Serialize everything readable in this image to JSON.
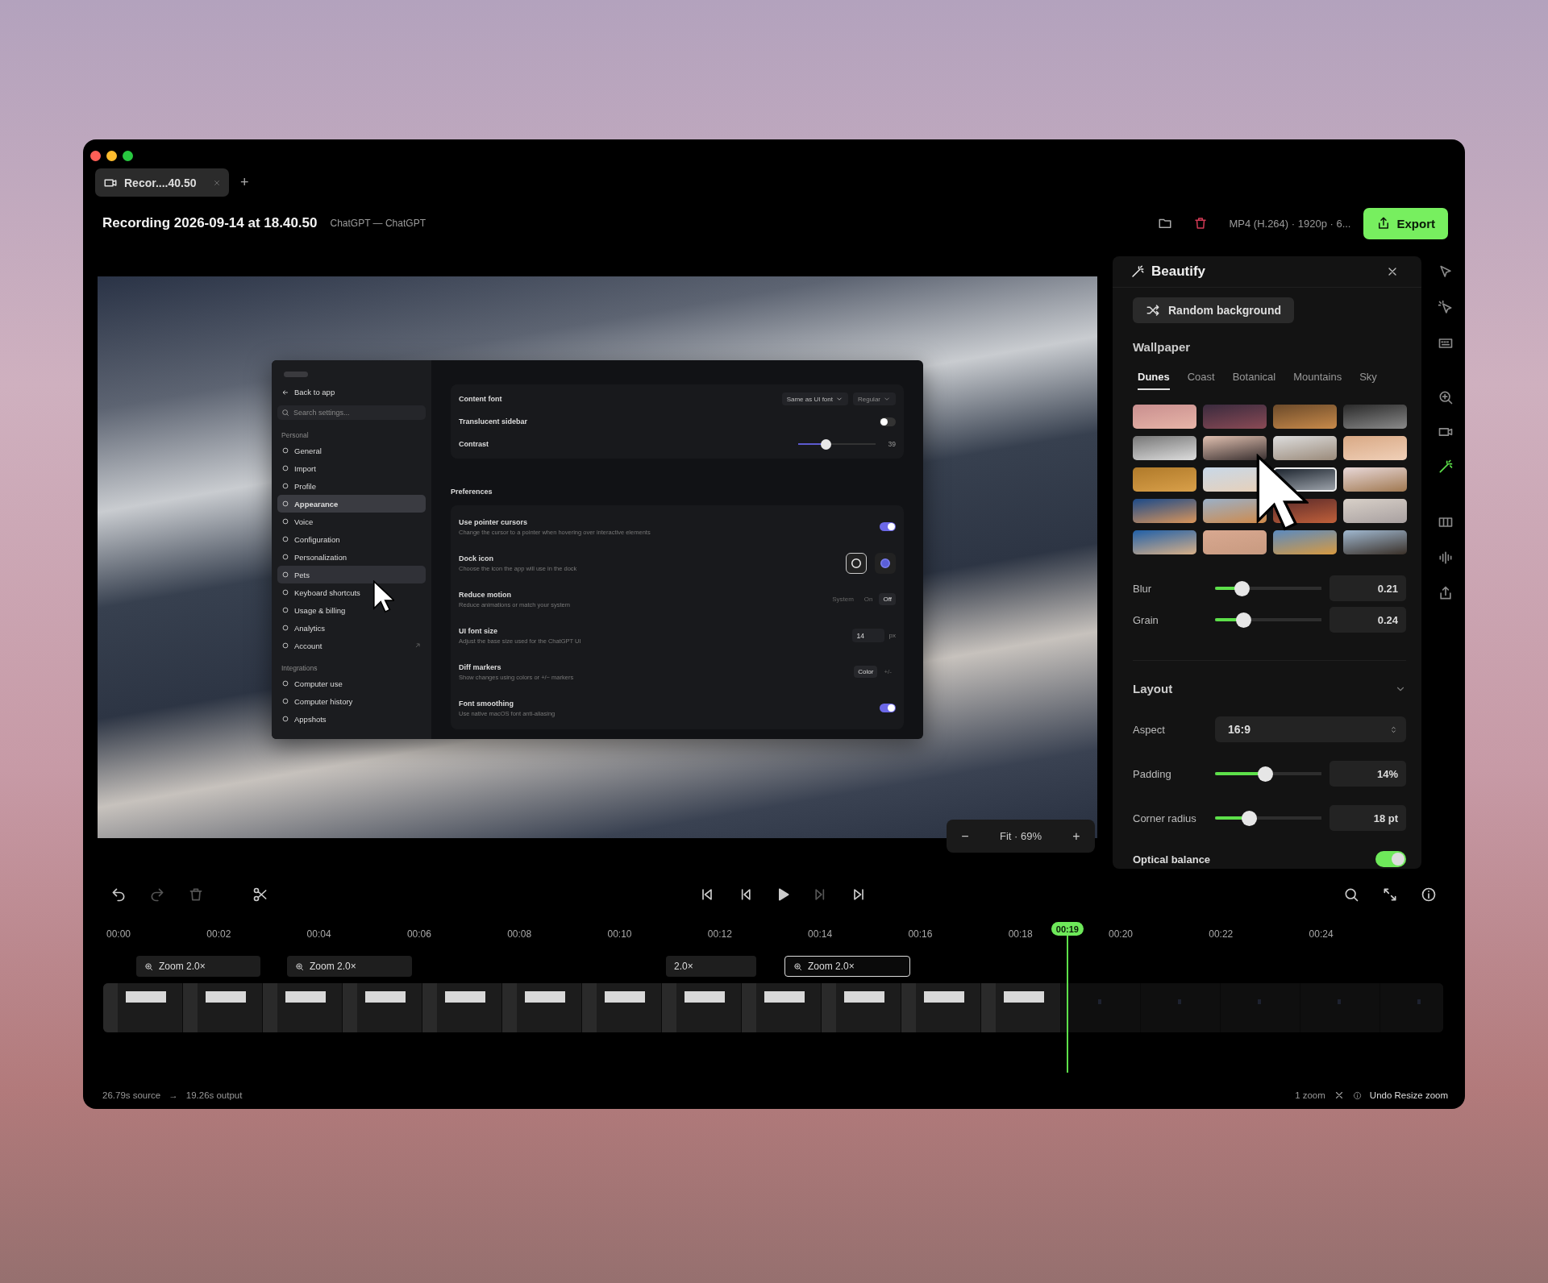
{
  "window": {
    "title": "Recording 2026-09-14 at 18.40.50",
    "subtitle": "ChatGPT — ChatGPT"
  },
  "tabs": [
    {
      "label": "Recor....40.50",
      "selected": true
    }
  ],
  "new_tab": "+",
  "toolbar": {
    "format": "MP4 (H.264) · 1920p · 6...",
    "export": "Export"
  },
  "preview": {
    "app": {
      "back": "Back to app",
      "search_placeholder": "Search settings...",
      "sections": [
        {
          "heading": "Personal",
          "items": [
            {
              "label": "General",
              "kind": "page",
              "selected": false,
              "hovered": false
            },
            {
              "label": "Import",
              "kind": "page",
              "selected": false,
              "hovered": false
            },
            {
              "label": "Profile",
              "kind": "page",
              "selected": false,
              "hovered": false
            },
            {
              "label": "Appearance",
              "kind": "page",
              "selected": true,
              "hovered": false
            },
            {
              "label": "Voice",
              "kind": "page",
              "selected": false,
              "hovered": false
            },
            {
              "label": "Configuration",
              "kind": "page",
              "selected": false,
              "hovered": false
            },
            {
              "label": "Personalization",
              "kind": "page",
              "selected": false,
              "hovered": false
            },
            {
              "label": "Pets",
              "kind": "page",
              "selected": false,
              "hovered": true
            },
            {
              "label": "Keyboard shortcuts",
              "kind": "page",
              "selected": false,
              "hovered": false
            },
            {
              "label": "Usage & billing",
              "kind": "page",
              "selected": false,
              "hovered": false
            },
            {
              "label": "Analytics",
              "kind": "page",
              "selected": false,
              "hovered": false
            },
            {
              "label": "Account",
              "kind": "external",
              "selected": false,
              "hovered": false
            }
          ]
        },
        {
          "heading": "Integrations",
          "items": [
            {
              "label": "Computer use",
              "kind": "page",
              "selected": false,
              "hovered": false
            },
            {
              "label": "Computer history",
              "kind": "page",
              "selected": false,
              "hovered": false
            },
            {
              "label": "Appshots",
              "kind": "page",
              "selected": false,
              "hovered": false
            }
          ]
        }
      ],
      "top_rows": [
        {
          "kind": "select",
          "label": "Content font",
          "options": [
            "Same as UI font",
            "Regular"
          ]
        },
        {
          "kind": "toggle",
          "label": "Translucent sidebar",
          "on": false
        },
        {
          "kind": "slider",
          "label": "Contrast",
          "level": 0.36,
          "value": "39"
        }
      ],
      "section": "Preferences",
      "rows": [
        {
          "kind": "toggle",
          "label": "Use pointer cursors",
          "description": "Change the cursor to a pointer when hovering over interactive elements",
          "on": true
        },
        {
          "kind": "icons",
          "label": "Dock icon",
          "description": "Choose the icon the app will use in the dock",
          "options": [
            {
              "selected": true
            },
            {
              "selected": false
            }
          ]
        },
        {
          "kind": "segmented",
          "label": "Reduce motion",
          "description": "Reduce animations or match your system",
          "options": [
            {
              "label": "System",
              "selected": false
            },
            {
              "label": "On",
              "selected": false
            },
            {
              "label": "Off",
              "selected": true
            }
          ]
        },
        {
          "kind": "number",
          "label": "UI font size",
          "description": "Adjust the base size used for the ChatGPT UI",
          "value": "14",
          "unit": "px"
        },
        {
          "kind": "segmented",
          "label": "Diff markers",
          "description": "Show changes using colors or +/− markers",
          "options": [
            {
              "label": "Color",
              "selected": true
            },
            {
              "label": "+/-",
              "selected": false
            }
          ]
        },
        {
          "kind": "toggle",
          "label": "Font smoothing",
          "description": "Use native macOS font anti-aliasing",
          "on": true
        }
      ]
    },
    "zoom": {
      "minus": "−",
      "label": "Fit · 69%",
      "plus": "+"
    }
  },
  "panel": {
    "title": "Beautify",
    "random_button": "Random background",
    "wallpaper": {
      "heading": "Wallpaper",
      "tabs": [
        {
          "label": "Dunes",
          "selected": true
        },
        {
          "label": "Coast",
          "selected": false
        },
        {
          "label": "Botanical",
          "selected": false
        },
        {
          "label": "Mountains",
          "selected": false
        },
        {
          "label": "Sky",
          "selected": false
        }
      ],
      "thumbnails": [
        {
          "selected": false
        },
        {
          "selected": false
        },
        {
          "selected": false
        },
        {
          "selected": false
        },
        {
          "selected": false
        },
        {
          "selected": false
        },
        {
          "selected": false
        },
        {
          "selected": false
        },
        {
          "selected": false
        },
        {
          "selected": false
        },
        {
          "selected": true
        },
        {
          "selected": false
        },
        {
          "selected": false
        },
        {
          "selected": false
        },
        {
          "selected": false
        },
        {
          "selected": false
        },
        {
          "selected": false
        },
        {
          "selected": false
        },
        {
          "selected": false
        },
        {
          "selected": false
        }
      ]
    },
    "effects": [
      {
        "label": "Blur",
        "level": 0.25,
        "value": "0.21"
      },
      {
        "label": "Grain",
        "level": 0.27,
        "value": "0.24"
      }
    ],
    "layout": {
      "heading": "Layout",
      "expanded": true,
      "rows": [
        {
          "kind": "select",
          "label": "Aspect",
          "value": "16:9"
        },
        {
          "kind": "slider",
          "label": "Padding",
          "level": 0.47,
          "value": "14%"
        },
        {
          "kind": "slider",
          "label": "Corner radius",
          "level": 0.32,
          "value": "18 pt"
        },
        {
          "kind": "toggle",
          "label": "Optical balance",
          "on": true
        }
      ]
    }
  },
  "tools": [
    {
      "kind": "pointer",
      "selected": false
    },
    {
      "kind": "click",
      "selected": false
    },
    {
      "kind": "keyboard",
      "selected": false
    },
    {
      "kind": "zoom",
      "selected": false
    },
    {
      "kind": "camera",
      "selected": false
    },
    {
      "kind": "beautify",
      "selected": true
    },
    {
      "kind": "frames",
      "selected": false
    },
    {
      "kind": "audio",
      "selected": false
    },
    {
      "kind": "share",
      "selected": false
    }
  ],
  "timeline": {
    "edit_tools": [
      {
        "kind": "undo",
        "disabled": false
      },
      {
        "kind": "redo",
        "disabled": true
      },
      {
        "kind": "delete",
        "disabled": true
      },
      {
        "kind": "cut",
        "disabled": false
      }
    ],
    "transport": [
      {
        "kind": "skip_start",
        "disabled": false
      },
      {
        "kind": "step_back",
        "disabled": false
      },
      {
        "kind": "play",
        "disabled": false
      },
      {
        "kind": "step_forward",
        "disabled": true
      },
      {
        "kind": "skip_end",
        "disabled": false
      }
    ],
    "view_tools": [
      {
        "kind": "search"
      },
      {
        "kind": "fit"
      },
      {
        "kind": "info"
      }
    ],
    "ruler": [
      "00:00",
      "00:02",
      "00:04",
      "00:06",
      "00:08",
      "00:10",
      "00:12",
      "00:14",
      "00:16",
      "00:18",
      "00:20",
      "00:22",
      "00:24"
    ],
    "playhead": {
      "label": "00:19",
      "level": 0.7165
    },
    "segments": [
      {
        "kind": "zoom",
        "label": "Zoom 2.0×",
        "selected": false
      },
      {
        "kind": "zoom",
        "label": "Zoom 2.0×",
        "selected": false
      },
      {
        "kind": "compact",
        "label": "2.0×",
        "selected": false
      },
      {
        "kind": "zoom",
        "label": "Zoom 2.0×",
        "selected": true
      }
    ]
  },
  "status_bar": {
    "source": "26.79s source",
    "arrow": "→",
    "output": "19.26s output",
    "zooms": "1 zoom",
    "action": "Undo Resize zoom"
  }
}
